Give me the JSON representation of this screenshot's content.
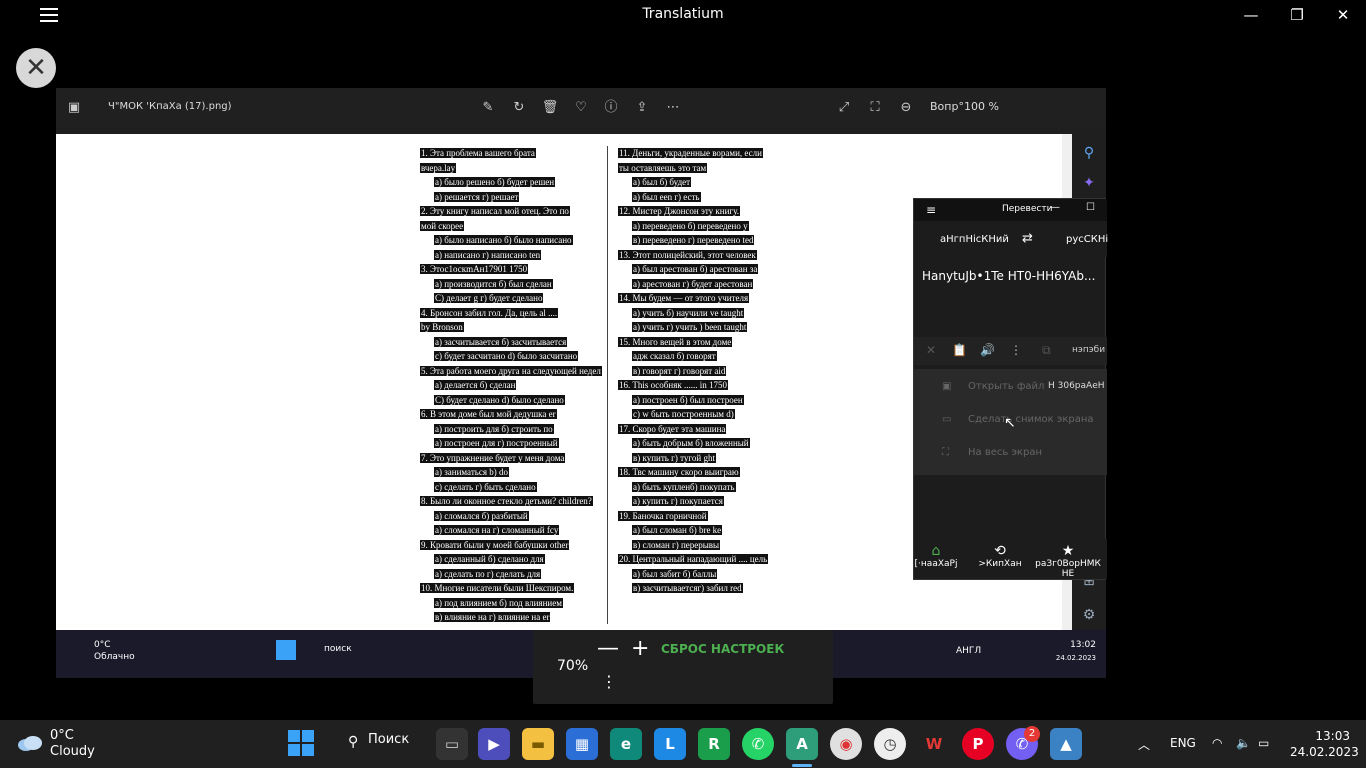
{
  "app": {
    "title": "Translatium"
  },
  "window_controls": {
    "minimize": "—",
    "maximize": "❐",
    "close": "✕"
  },
  "close_button": {
    "label": "✕"
  },
  "viewer": {
    "filename": "Ч\"МОК 'КпаХа (17).png)",
    "zoom_text": "Вопр°100 %",
    "toolbar_icons": [
      "edit-icon",
      "rotate-icon",
      "delete-icon",
      "heart-icon",
      "info-icon",
      "share-icon",
      "more-icon"
    ]
  },
  "document": {
    "left": [
      "1.  Эта проблема вашего брата",
      "     вчера.lay",
      "a) было решено   б) будет решен",
      "a) решается        г) решает",
      "2. Эту книгу написал мой отец. Это по",
      "     мой скорее",
      "a) было написано б) было написано",
      "a) написано г) написано ten",
      "3. Этос1оскmАн17901  1750",
      "a) производится  б) был сделан",
      "C) делает g        г) будет сделано",
      "4. Бронсон забил гол. Да, цель al ....",
      "     by Bronson",
      "a) засчитывается б) засчитывается",
      "c) будет засчитано d) было засчитано",
      "5. Эта работа моего друга на следующей недел",
      "a) делается        б) сделан",
      "C) будет сделано d) было сделано",
      "6. В этом доме был мой дедушка er",
      "a) построить для  б) строить по",
      "a) построен для   г) построенный",
      "7. Это упражнение будет у меня дома",
      "a) заниматься     b) do",
      "c) сделать         г) быть сделано",
      "8. Было ли оконное стекло детьми? children?",
      "a) сломался        б) разбитый",
      "a) сломался на    г) сломанный fcy",
      "9. Кровати были у моей бабушки other",
      "a) сделанный      б) сделано для",
      "a) сделать по      г) сделать для",
      "10. Многие писатели были Шекспиром.",
      "a) под влиянием б) под влиянием",
      "в) влияние на г) влияние на er"
    ],
    "right": [
      "11. Деньги, украденные ворами, если",
      "     ты оставляешь это там",
      "a) был              б) будет",
      "a) был een         г) есть",
      "12. Мистер Джонсон эту книгу.",
      "a) переведено б) переведено y",
      "в) переведено г) переведено ted",
      "13. Этот полицейский, этот человек",
      "a) был арестован б) арестован за",
      "a) арестован       г) будет арестован",
      "14. Мы будем — от этого учителя",
      "a) учить б) научили ve taught",
      "a) учить г) учить ) been taught",
      "15. Много вещей в этом доме",
      "адж сказал          б) говорят",
      "в) говорят          г) говорят aid",
      "16. This особняк ...... in 1750",
      "a) построен        б) был построен",
      "c) w быть построенным d)",
      "17. Скоро будет эта машина",
      "a) быть добрым  б) вложенный",
      "в) купить           г) тугой ght",
      "18. Твс машину скоро выиграю",
      "a) быть купленб) покупать",
      "a) купить           г) покупается",
      "19. Баночка горничной",
      "a) был сломан б) bre ke",
      "в) сломан         г) перерывы",
      "20. Центральный нападающий .... цель",
      "a) был забит       б) баллы",
      "в) засчитываетсяг) забил red"
    ]
  },
  "translator": {
    "title": "Перевести",
    "source_lang": "аНгпНісКНий",
    "swap": "⇄",
    "target_lang": "русСКНі",
    "text": "HanytuJb•1Te HT0-HH6YAb...",
    "toolbar_placeholder": "нэпэби",
    "menu": [
      "Открыть файл",
      "Сделать снимок экрана",
      "На весь экран"
    ],
    "menu_hint": "Н 306раАеН",
    "nav": [
      "[·наaXaPj",
      ">КипХан",
      "раЗг0ВорНМК НЕ"
    ]
  },
  "zoom_panel": {
    "percent": "70%",
    "minus": "—",
    "plus": "+",
    "reset": "СБРОС НАСТРОЕК",
    "more": "⋮"
  },
  "inner_taskbar": {
    "temp": "0°C",
    "weather": "Облачно",
    "search": "поиск",
    "lang": "АНГЛ",
    "time": "13:02",
    "date": "24.02.2023"
  },
  "taskbar": {
    "temp": "0°C",
    "weather": "Cloudy",
    "search": "Поиск",
    "lang": "ENG",
    "time": "13:03",
    "date": "24.02.2023",
    "viber_badge": "2",
    "colors": {
      "accent": "#3ba3f7",
      "bg": "#202020"
    }
  }
}
